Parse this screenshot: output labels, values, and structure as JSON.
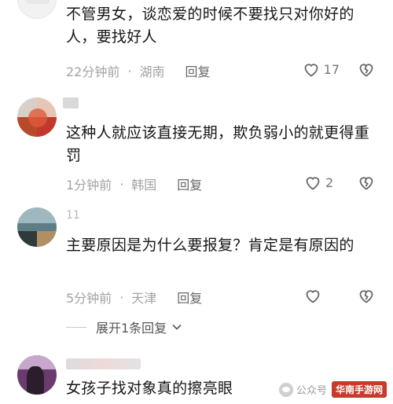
{
  "comments": [
    {
      "text": "不管男女，谈恋爱的时候不要找只对你好的人，要找好人",
      "time": "22分钟前",
      "location": "湖南",
      "reply_label": "回复",
      "likes": "17"
    },
    {
      "text": "这种人就应该直接无期，欺负弱小的就更得重罚",
      "time": "1分钟前",
      "location": "韩国",
      "reply_label": "回复",
      "likes": "2"
    },
    {
      "username": "11",
      "text": "主要原因是为什么要报复？肯定是有原因的",
      "time": "5分钟前",
      "location": "天津",
      "reply_label": "回复",
      "likes": ""
    },
    {
      "text": "女孩子找对象真的擦亮眼"
    }
  ],
  "expand_replies": "展开1条回复",
  "watermark": {
    "prefix": "公众号",
    "logo": "华南手游网"
  },
  "icons": {
    "like": "heart-outline-icon",
    "dislike": "broken-heart-icon",
    "expand": "chevron-down-icon"
  }
}
